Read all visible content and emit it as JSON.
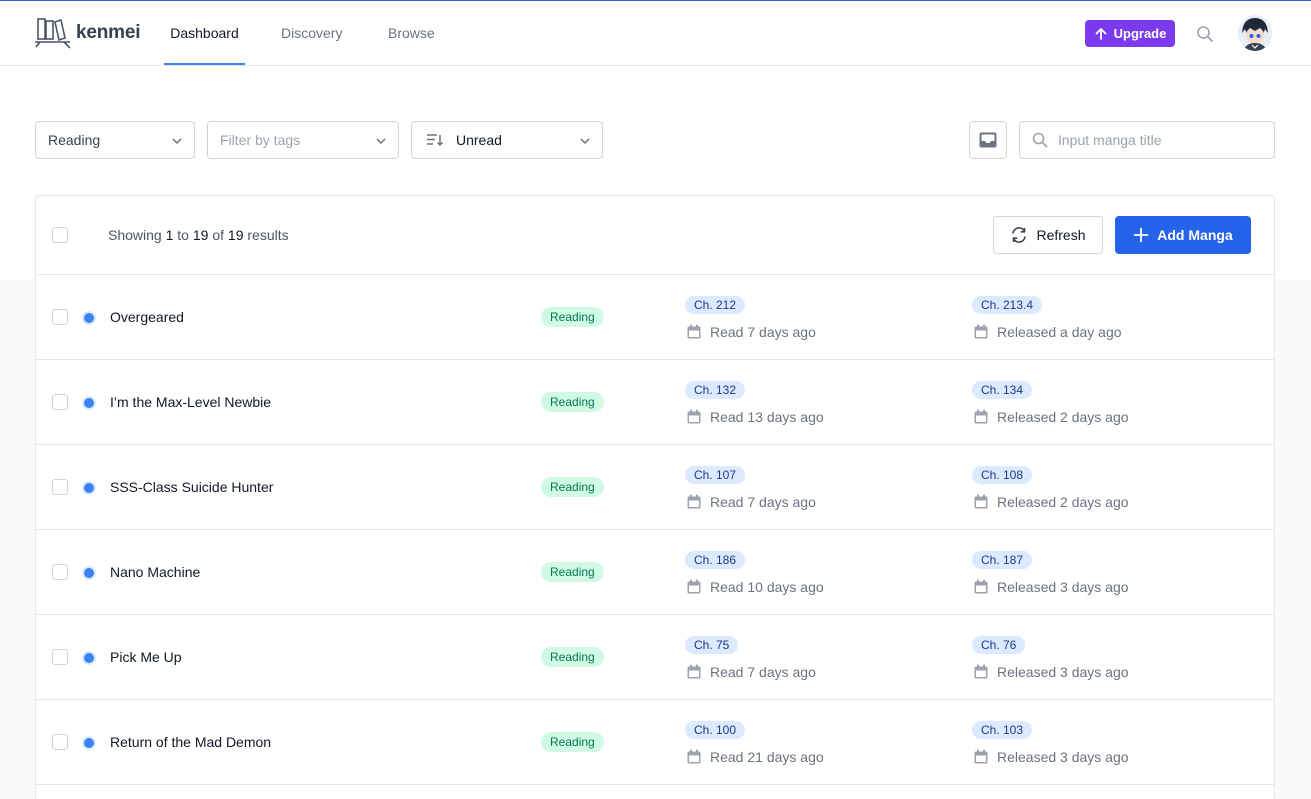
{
  "app": {
    "name": "kenmei"
  },
  "nav": [
    {
      "label": "Dashboard",
      "active": true
    },
    {
      "label": "Discovery",
      "active": false
    },
    {
      "label": "Browse",
      "active": false
    }
  ],
  "header": {
    "upgrade_label": "Upgrade"
  },
  "filters": {
    "status": "Reading",
    "tags_placeholder": "Filter by tags",
    "sort": "Unread",
    "search_placeholder": "Input manga title"
  },
  "list": {
    "showing": {
      "prefix": "Showing",
      "from": "1",
      "to_word": "to",
      "to": "19",
      "of_word": "of",
      "total": "19",
      "suffix": "results"
    },
    "refresh_label": "Refresh",
    "add_label": "Add Manga",
    "items": [
      {
        "title": "Overgeared",
        "status": "Reading",
        "last_read": "Ch. 212",
        "read_ago": "Read 7 days ago",
        "latest": "Ch. 213.4",
        "released_ago": "Released a day ago"
      },
      {
        "title": "I’m the Max-Level Newbie",
        "status": "Reading",
        "last_read": "Ch. 132",
        "read_ago": "Read 13 days ago",
        "latest": "Ch. 134",
        "released_ago": "Released 2 days ago"
      },
      {
        "title": "SSS-Class Suicide Hunter",
        "status": "Reading",
        "last_read": "Ch. 107",
        "read_ago": "Read 7 days ago",
        "latest": "Ch. 108",
        "released_ago": "Released 2 days ago"
      },
      {
        "title": "Nano Machine",
        "status": "Reading",
        "last_read": "Ch. 186",
        "read_ago": "Read 10 days ago",
        "latest": "Ch. 187",
        "released_ago": "Released 3 days ago"
      },
      {
        "title": "Pick Me Up",
        "status": "Reading",
        "last_read": "Ch. 75",
        "read_ago": "Read 7 days ago",
        "latest": "Ch. 76",
        "released_ago": "Released 3 days ago"
      },
      {
        "title": "Return of the Mad Demon",
        "status": "Reading",
        "last_read": "Ch. 100",
        "read_ago": "Read 21 days ago",
        "latest": "Ch. 103",
        "released_ago": "Released 3 days ago"
      }
    ]
  },
  "colors": {
    "primary": "#2563eb",
    "upgrade": "#7c3aed",
    "reading_badge_bg": "#d1fae5",
    "reading_badge_text": "#047857",
    "unread_dot": "#3b82f6"
  }
}
